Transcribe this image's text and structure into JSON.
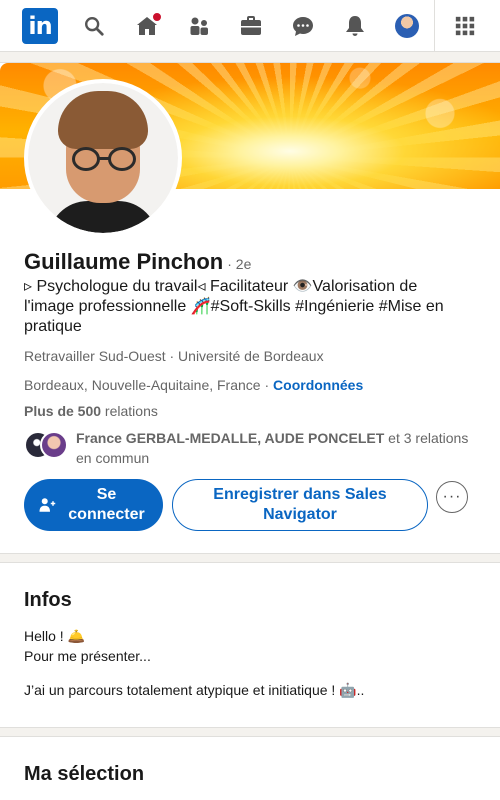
{
  "nav": {
    "logo_text": "in",
    "icons": [
      "search-icon",
      "home-icon",
      "network-icon",
      "jobs-icon",
      "messaging-icon",
      "notifications-icon",
      "me-avatar",
      "apps-grid-icon"
    ],
    "badge_color": "#cb112d",
    "brand_color": "#0a66c2"
  },
  "profile": {
    "name": "Guillaume Pinchon",
    "degree": "· 2e",
    "headline": "▹ Psychologue du travail◃ Facilitateur 👁️Valorisation de l'image professionnelle 🎢#Soft-Skills #Ingénierie #Mise en pratique",
    "education": "Retravailler Sud-Ouest · Université de Bordeaux",
    "location": "Bordeaux, Nouvelle-Aquitaine, France",
    "location_sep": " · ",
    "contact_link": "Coordonnées",
    "relations_count": "Plus de 500",
    "relations_label": " relations",
    "mutual_names": "France GERBAL-MEDALLE, AUDE PONCELET",
    "mutual_rest": " et 3 relations en commun"
  },
  "actions": {
    "connect_label": "Se connecter",
    "sales_label": "Enregistrer dans Sales Navigator",
    "more_label": "···"
  },
  "infos": {
    "title": "Infos",
    "line1": "Hello ! 🛎️",
    "line2": "Pour me présenter...",
    "line3": "J’ai un parcours totalement atypique et initiatique ! 🤖.."
  },
  "selection": {
    "title": "Ma sélection"
  }
}
